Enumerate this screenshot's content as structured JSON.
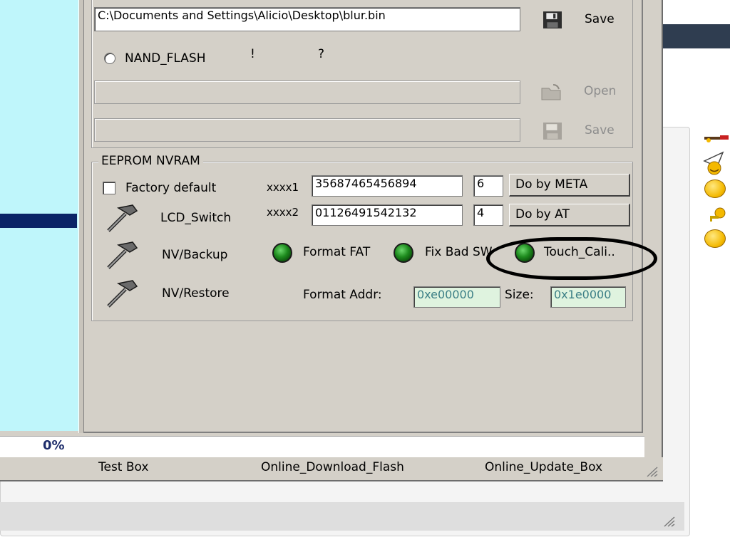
{
  "flash": {
    "path": "C:\\Documents and Settings\\Alicio\\Desktop\\blur.bin",
    "save_label": "Save",
    "nand_label": "NAND_FLASH",
    "mark_exclaim": "!",
    "mark_question": "?",
    "open_label": "Open",
    "save2_label": "Save"
  },
  "eeprom": {
    "group_title": "EEPROM NVRAM",
    "factory_default_label": "Factory default",
    "lcd_switch_label": "LCD_Switch",
    "nv_backup_label": "NV/Backup",
    "nv_restore_label": "NV/Restore",
    "xxxx1_label": "xxxx1",
    "xxxx1_value": "35687465456894",
    "xxxx1_digit": "6",
    "xxxx2_label": "xxxx2",
    "xxxx2_value": "01126491542132",
    "xxxx2_digit": "4",
    "do_by_meta_label": "Do by META",
    "do_by_at_label": "Do by AT",
    "format_fat_label": "Format FAT",
    "fix_bad_sw_label": "Fix Bad SW",
    "touch_cali_label": "Touch_Cali..",
    "format_addr_label": "Format Addr:",
    "format_addr_value": "0xe00000",
    "size_label": "Size:",
    "size_value": "0x1e0000"
  },
  "progress": {
    "percent_text": "0%"
  },
  "status_bar": {
    "item1": "Test Box",
    "item2": "Online_Download_Flash",
    "item3": "Online_Update_Box"
  },
  "colors": {
    "accent": "#0a2466",
    "cyan_panel": "#bff6fb",
    "dialog_bg": "#d4d0c8",
    "led_green": "#1d8a1d",
    "hex_field_bg": "#dff3df"
  }
}
